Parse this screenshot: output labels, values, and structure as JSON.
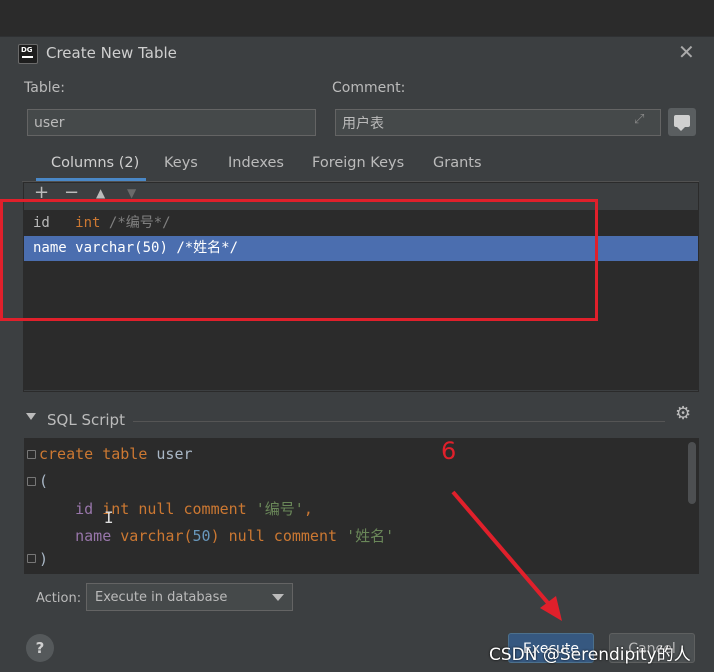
{
  "window": {
    "title": "Create New Table",
    "icon_text": "DG"
  },
  "form": {
    "table_label": "Table:",
    "table_value": "user",
    "comment_label": "Comment:",
    "comment_value": "用户表"
  },
  "tabs": [
    {
      "label": "Columns (2)",
      "active": true
    },
    {
      "label": "Keys",
      "active": false
    },
    {
      "label": "Indexes",
      "active": false
    },
    {
      "label": "Foreign Keys",
      "active": false
    },
    {
      "label": "Grants",
      "active": false
    }
  ],
  "toolbar": {
    "add": "+",
    "remove": "−",
    "up": "▲",
    "down": "▼"
  },
  "columns": [
    {
      "name": "id",
      "type": "int",
      "comment": "/*编号*/",
      "selected": false
    },
    {
      "name": "name",
      "type": "varchar(50)",
      "comment": "/*姓名*/",
      "selected": true
    }
  ],
  "sql_script": {
    "label": "SQL Script",
    "lines": {
      "l1_kw": "create table ",
      "l1_name": "user",
      "l2": "(",
      "l3_id": "id ",
      "l3_kw": "int null comment ",
      "l3_str": "'编号'",
      "l3_end": ",",
      "l4_id": "name ",
      "l4_kw1": "varchar(",
      "l4_num": "50",
      "l4_kw2": ") null comment ",
      "l4_str": "'姓名'",
      "l5": ")"
    }
  },
  "action": {
    "label": "Action:",
    "value": "Execute in database"
  },
  "buttons": {
    "help": "?",
    "execute": "Execute",
    "cancel": "Cancel"
  },
  "annotation": {
    "number": "6"
  },
  "watermark": "CSDN @Serendipity的人",
  "colors": {
    "highlight_box": "#e0202b",
    "selection": "#4b6eaf",
    "primary": "#365880"
  }
}
